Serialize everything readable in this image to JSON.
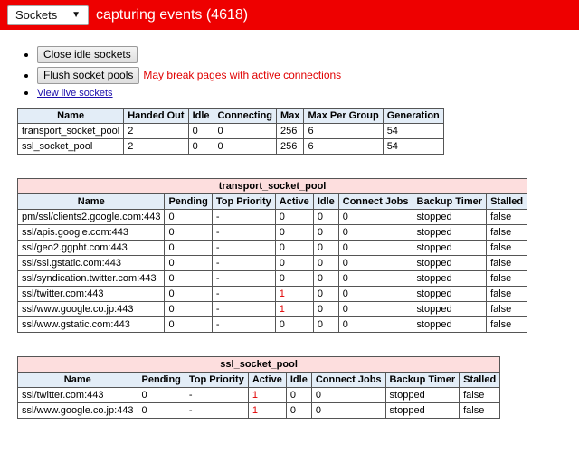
{
  "header": {
    "view_select": "Sockets",
    "title": "capturing events (4618)"
  },
  "actions": {
    "close_idle": "Close idle sockets",
    "flush_pools": "Flush socket pools",
    "flush_warning": "May break pages with active connections",
    "view_live": "View live sockets"
  },
  "summary": {
    "headers": [
      "Name",
      "Handed Out",
      "Idle",
      "Connecting",
      "Max",
      "Max Per Group",
      "Generation"
    ],
    "rows": [
      [
        "transport_socket_pool",
        "2",
        "0",
        "0",
        "256",
        "6",
        "54"
      ],
      [
        "ssl_socket_pool",
        "2",
        "0",
        "0",
        "256",
        "6",
        "54"
      ]
    ]
  },
  "transport_pool": {
    "caption": "transport_socket_pool",
    "headers": [
      "Name",
      "Pending",
      "Top Priority",
      "Active",
      "Idle",
      "Connect Jobs",
      "Backup Timer",
      "Stalled"
    ],
    "rows": [
      [
        "pm/ssl/clients2.google.com:443",
        "0",
        "-",
        "0",
        "0",
        "0",
        "stopped",
        "false"
      ],
      [
        "ssl/apis.google.com:443",
        "0",
        "-",
        "0",
        "0",
        "0",
        "stopped",
        "false"
      ],
      [
        "ssl/geo2.ggpht.com:443",
        "0",
        "-",
        "0",
        "0",
        "0",
        "stopped",
        "false"
      ],
      [
        "ssl/ssl.gstatic.com:443",
        "0",
        "-",
        "0",
        "0",
        "0",
        "stopped",
        "false"
      ],
      [
        "ssl/syndication.twitter.com:443",
        "0",
        "-",
        "0",
        "0",
        "0",
        "stopped",
        "false"
      ],
      [
        "ssl/twitter.com:443",
        "0",
        "-",
        "1",
        "0",
        "0",
        "stopped",
        "false"
      ],
      [
        "ssl/www.google.co.jp:443",
        "0",
        "-",
        "1",
        "0",
        "0",
        "stopped",
        "false"
      ],
      [
        "ssl/www.gstatic.com:443",
        "0",
        "-",
        "0",
        "0",
        "0",
        "stopped",
        "false"
      ]
    ]
  },
  "ssl_pool": {
    "caption": "ssl_socket_pool",
    "headers": [
      "Name",
      "Pending",
      "Top Priority",
      "Active",
      "Idle",
      "Connect Jobs",
      "Backup Timer",
      "Stalled"
    ],
    "rows": [
      [
        "ssl/twitter.com:443",
        "0",
        "-",
        "1",
        "0",
        "0",
        "stopped",
        "false"
      ],
      [
        "ssl/www.google.co.jp:443",
        "0",
        "-",
        "1",
        "0",
        "0",
        "stopped",
        "false"
      ]
    ]
  },
  "colors": {
    "topbar": "#ee0000",
    "header_blue": "#e3edf7",
    "header_pink": "#fddede",
    "warning": "#e00000",
    "link": "#1a0dab"
  }
}
